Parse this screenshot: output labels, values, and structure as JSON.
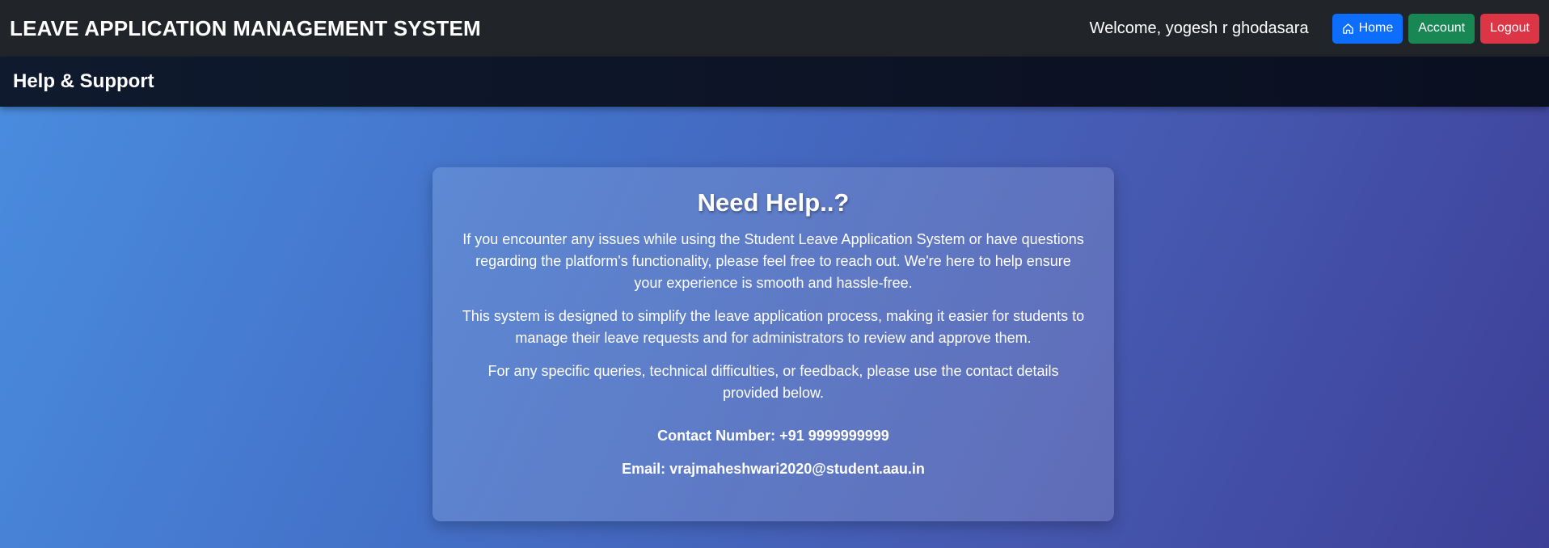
{
  "navbar": {
    "brand": "LEAVE APPLICATION MANAGEMENT SYSTEM",
    "welcome": "Welcome, yogesh r ghodasara",
    "buttons": {
      "home": "Home",
      "account": "Account",
      "logout": "Logout"
    }
  },
  "subheader": {
    "title": "Help & Support"
  },
  "help_card": {
    "heading": "Need Help..?",
    "paragraphs": [
      "If you encounter any issues while using the Student Leave Application System or have questions regarding the platform's functionality, please feel free to reach out. We're here to help ensure your experience is smooth and hassle-free.",
      "This system is designed to simplify the leave application process, making it easier for students to manage their leave requests and for administrators to review and approve them.",
      "For any specific queries, technical difficulties, or feedback, please use the contact details provided below."
    ],
    "contact_number": "Contact Number: +91 9999999999",
    "email": "Email: vrajmaheshwari2020@student.aau.in"
  },
  "icons": {
    "home": "home-icon"
  },
  "colors": {
    "navbar_bg": "#212529",
    "home_button": "#0d6efd",
    "account_button": "#198754",
    "logout_button": "#dc3545"
  }
}
